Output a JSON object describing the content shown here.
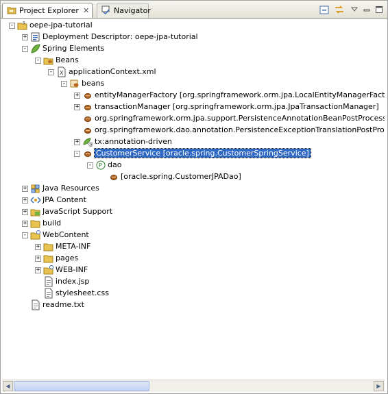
{
  "tabs": {
    "project_explorer": "Project Explorer",
    "navigator": "Navigator"
  },
  "tree": [
    {
      "label": "oepe-jpa-tutorial",
      "depth": 0,
      "toggle": "-",
      "icon": "project-icon"
    },
    {
      "label": "Deployment Descriptor: oepe-jpa-tutorial",
      "depth": 1,
      "toggle": "+",
      "icon": "deployment-descriptor-icon"
    },
    {
      "label": "Spring Elements",
      "depth": 1,
      "toggle": "-",
      "icon": "spring-leaf-icon"
    },
    {
      "label": "Beans",
      "depth": 2,
      "toggle": "-",
      "icon": "beans-folder-icon"
    },
    {
      "label": "applicationContext.xml",
      "depth": 3,
      "toggle": "-",
      "icon": "xml-file-icon"
    },
    {
      "label": "beans",
      "depth": 4,
      "toggle": "-",
      "icon": "beans-element-icon"
    },
    {
      "label": "entityManagerFactory [org.springframework.orm.jpa.LocalEntityManagerFactoryBean]",
      "depth": 5,
      "toggle": "+",
      "icon": "bean-icon"
    },
    {
      "label": "transactionManager [org.springframework.orm.jpa.JpaTransactionManager]",
      "depth": 5,
      "toggle": "+",
      "icon": "bean-icon"
    },
    {
      "label": "org.springframework.orm.jpa.support.PersistenceAnnotationBeanPostProcessor#oepe",
      "depth": 5,
      "toggle": "",
      "icon": "bean-icon"
    },
    {
      "label": "org.springframework.dao.annotation.PersistenceExceptionTranslationPostProcessor#o",
      "depth": 5,
      "toggle": "",
      "icon": "bean-icon"
    },
    {
      "label": "tx:annotation-driven",
      "depth": 5,
      "toggle": "+",
      "icon": "tx-annotation-icon"
    },
    {
      "label": "CustomerService [oracle.spring.CustomerSpringService]",
      "depth": 5,
      "toggle": "-",
      "icon": "bean-icon",
      "selected": true
    },
    {
      "label": "dao",
      "depth": 6,
      "toggle": "-",
      "icon": "property-icon"
    },
    {
      "label": "[oracle.spring.CustomerJPADao]",
      "depth": 7,
      "toggle": "",
      "icon": "bean-icon"
    },
    {
      "label": "Java Resources",
      "depth": 1,
      "toggle": "+",
      "icon": "java-resources-icon"
    },
    {
      "label": "JPA Content",
      "depth": 1,
      "toggle": "+",
      "icon": "jpa-content-icon"
    },
    {
      "label": "JavaScript Support",
      "depth": 1,
      "toggle": "+",
      "icon": "javascript-support-icon"
    },
    {
      "label": "build",
      "depth": 1,
      "toggle": "+",
      "icon": "folder-icon"
    },
    {
      "label": "WebContent",
      "depth": 1,
      "toggle": "-",
      "icon": "web-folder-icon"
    },
    {
      "label": "META-INF",
      "depth": 2,
      "toggle": "+",
      "icon": "folder-icon"
    },
    {
      "label": "pages",
      "depth": 2,
      "toggle": "+",
      "icon": "folder-icon"
    },
    {
      "label": "WEB-INF",
      "depth": 2,
      "toggle": "+",
      "icon": "web-folder-icon"
    },
    {
      "label": "index.jsp",
      "depth": 2,
      "toggle": "",
      "icon": "file-icon"
    },
    {
      "label": "stylesheet.css",
      "depth": 2,
      "toggle": "",
      "icon": "file-icon"
    },
    {
      "label": "readme.txt",
      "depth": 1,
      "toggle": "",
      "icon": "file-icon"
    }
  ],
  "colors": {
    "selection": "#316ac5",
    "folder": "#e8c352",
    "bean": "#b5651d",
    "spring": "#6db33f"
  }
}
